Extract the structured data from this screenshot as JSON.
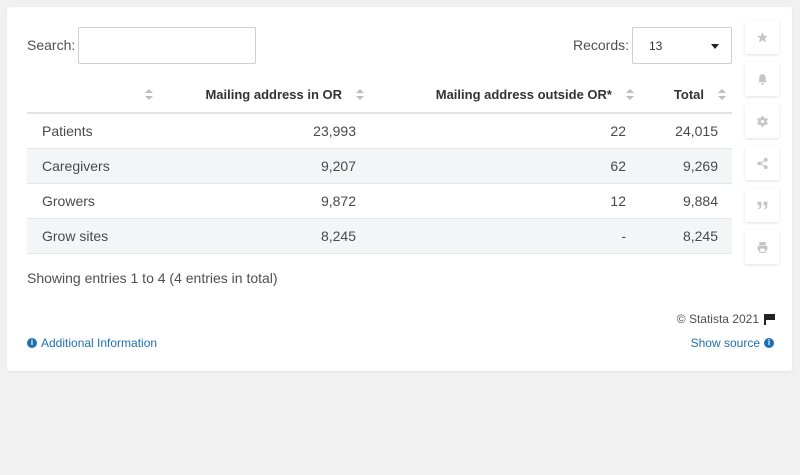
{
  "search": {
    "label": "Search:",
    "value": "",
    "placeholder": ""
  },
  "records": {
    "label": "Records:",
    "selected": "13"
  },
  "table": {
    "headers": [
      "",
      "Mailing address in OR",
      "Mailing address outside OR*",
      "Total"
    ],
    "rows": [
      [
        "Patients",
        "23,993",
        "22",
        "24,015"
      ],
      [
        "Caregivers",
        "9,207",
        "62",
        "9,269"
      ],
      [
        "Growers",
        "9,872",
        "12",
        "9,884"
      ],
      [
        "Grow sites",
        "8,245",
        "-",
        "8,245"
      ]
    ]
  },
  "footer": {
    "entries": "Showing entries 1 to 4 (4 entries in total)",
    "copyright": "© Statista 2021",
    "additional_info": "Additional Information",
    "show_source": "Show source"
  },
  "toolbar": [
    "star-icon",
    "bell-icon",
    "gear-icon",
    "share-icon",
    "quote-icon",
    "print-icon"
  ],
  "colors": {
    "link": "#1f6fb5",
    "row_alt": "#f3f5f7",
    "icon": "#c5c5c5"
  }
}
